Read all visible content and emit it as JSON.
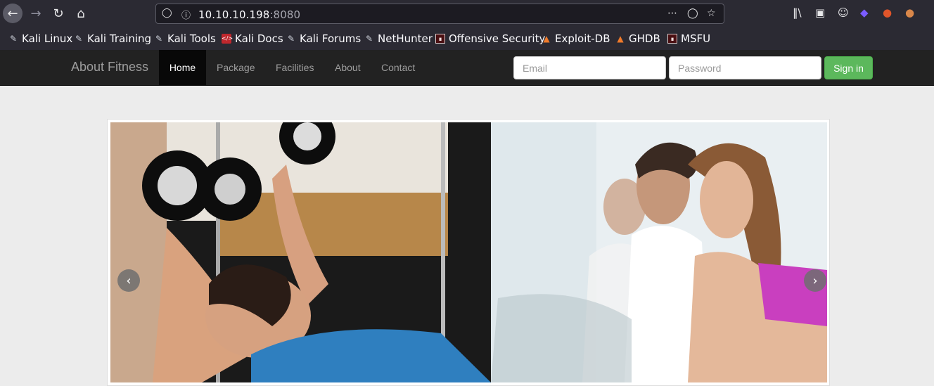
{
  "browser": {
    "url_host": "10.10.10.198",
    "url_port": ":8080",
    "bookmarks": [
      {
        "label": "Kali Linux",
        "icon": "kali-dragon-icon"
      },
      {
        "label": "Kali Training",
        "icon": "kali-dragon-icon"
      },
      {
        "label": "Kali Tools",
        "icon": "kali-dragon-icon"
      },
      {
        "label": "Kali Docs",
        "icon": "kali-docs-icon"
      },
      {
        "label": "Kali Forums",
        "icon": "kali-dragon-icon"
      },
      {
        "label": "NetHunter",
        "icon": "nethunter-icon"
      },
      {
        "label": "Offensive Security",
        "icon": "offsec-icon"
      },
      {
        "label": "Exploit-DB",
        "icon": "exploit-db-icon"
      },
      {
        "label": "GHDB",
        "icon": "exploit-db-icon"
      },
      {
        "label": "MSFU",
        "icon": "offsec-icon"
      }
    ]
  },
  "site": {
    "brand": "About Fitness",
    "menu": [
      "Home",
      "Package",
      "Facilities",
      "About",
      "Contact"
    ],
    "active_menu": "Home",
    "email_placeholder": "Email",
    "password_placeholder": "Password",
    "signin_label": "Sign in"
  },
  "colors": {
    "navbar_bg": "#222222",
    "signin_green": "#5cb85c",
    "chrome_bg": "#2b2a33"
  }
}
